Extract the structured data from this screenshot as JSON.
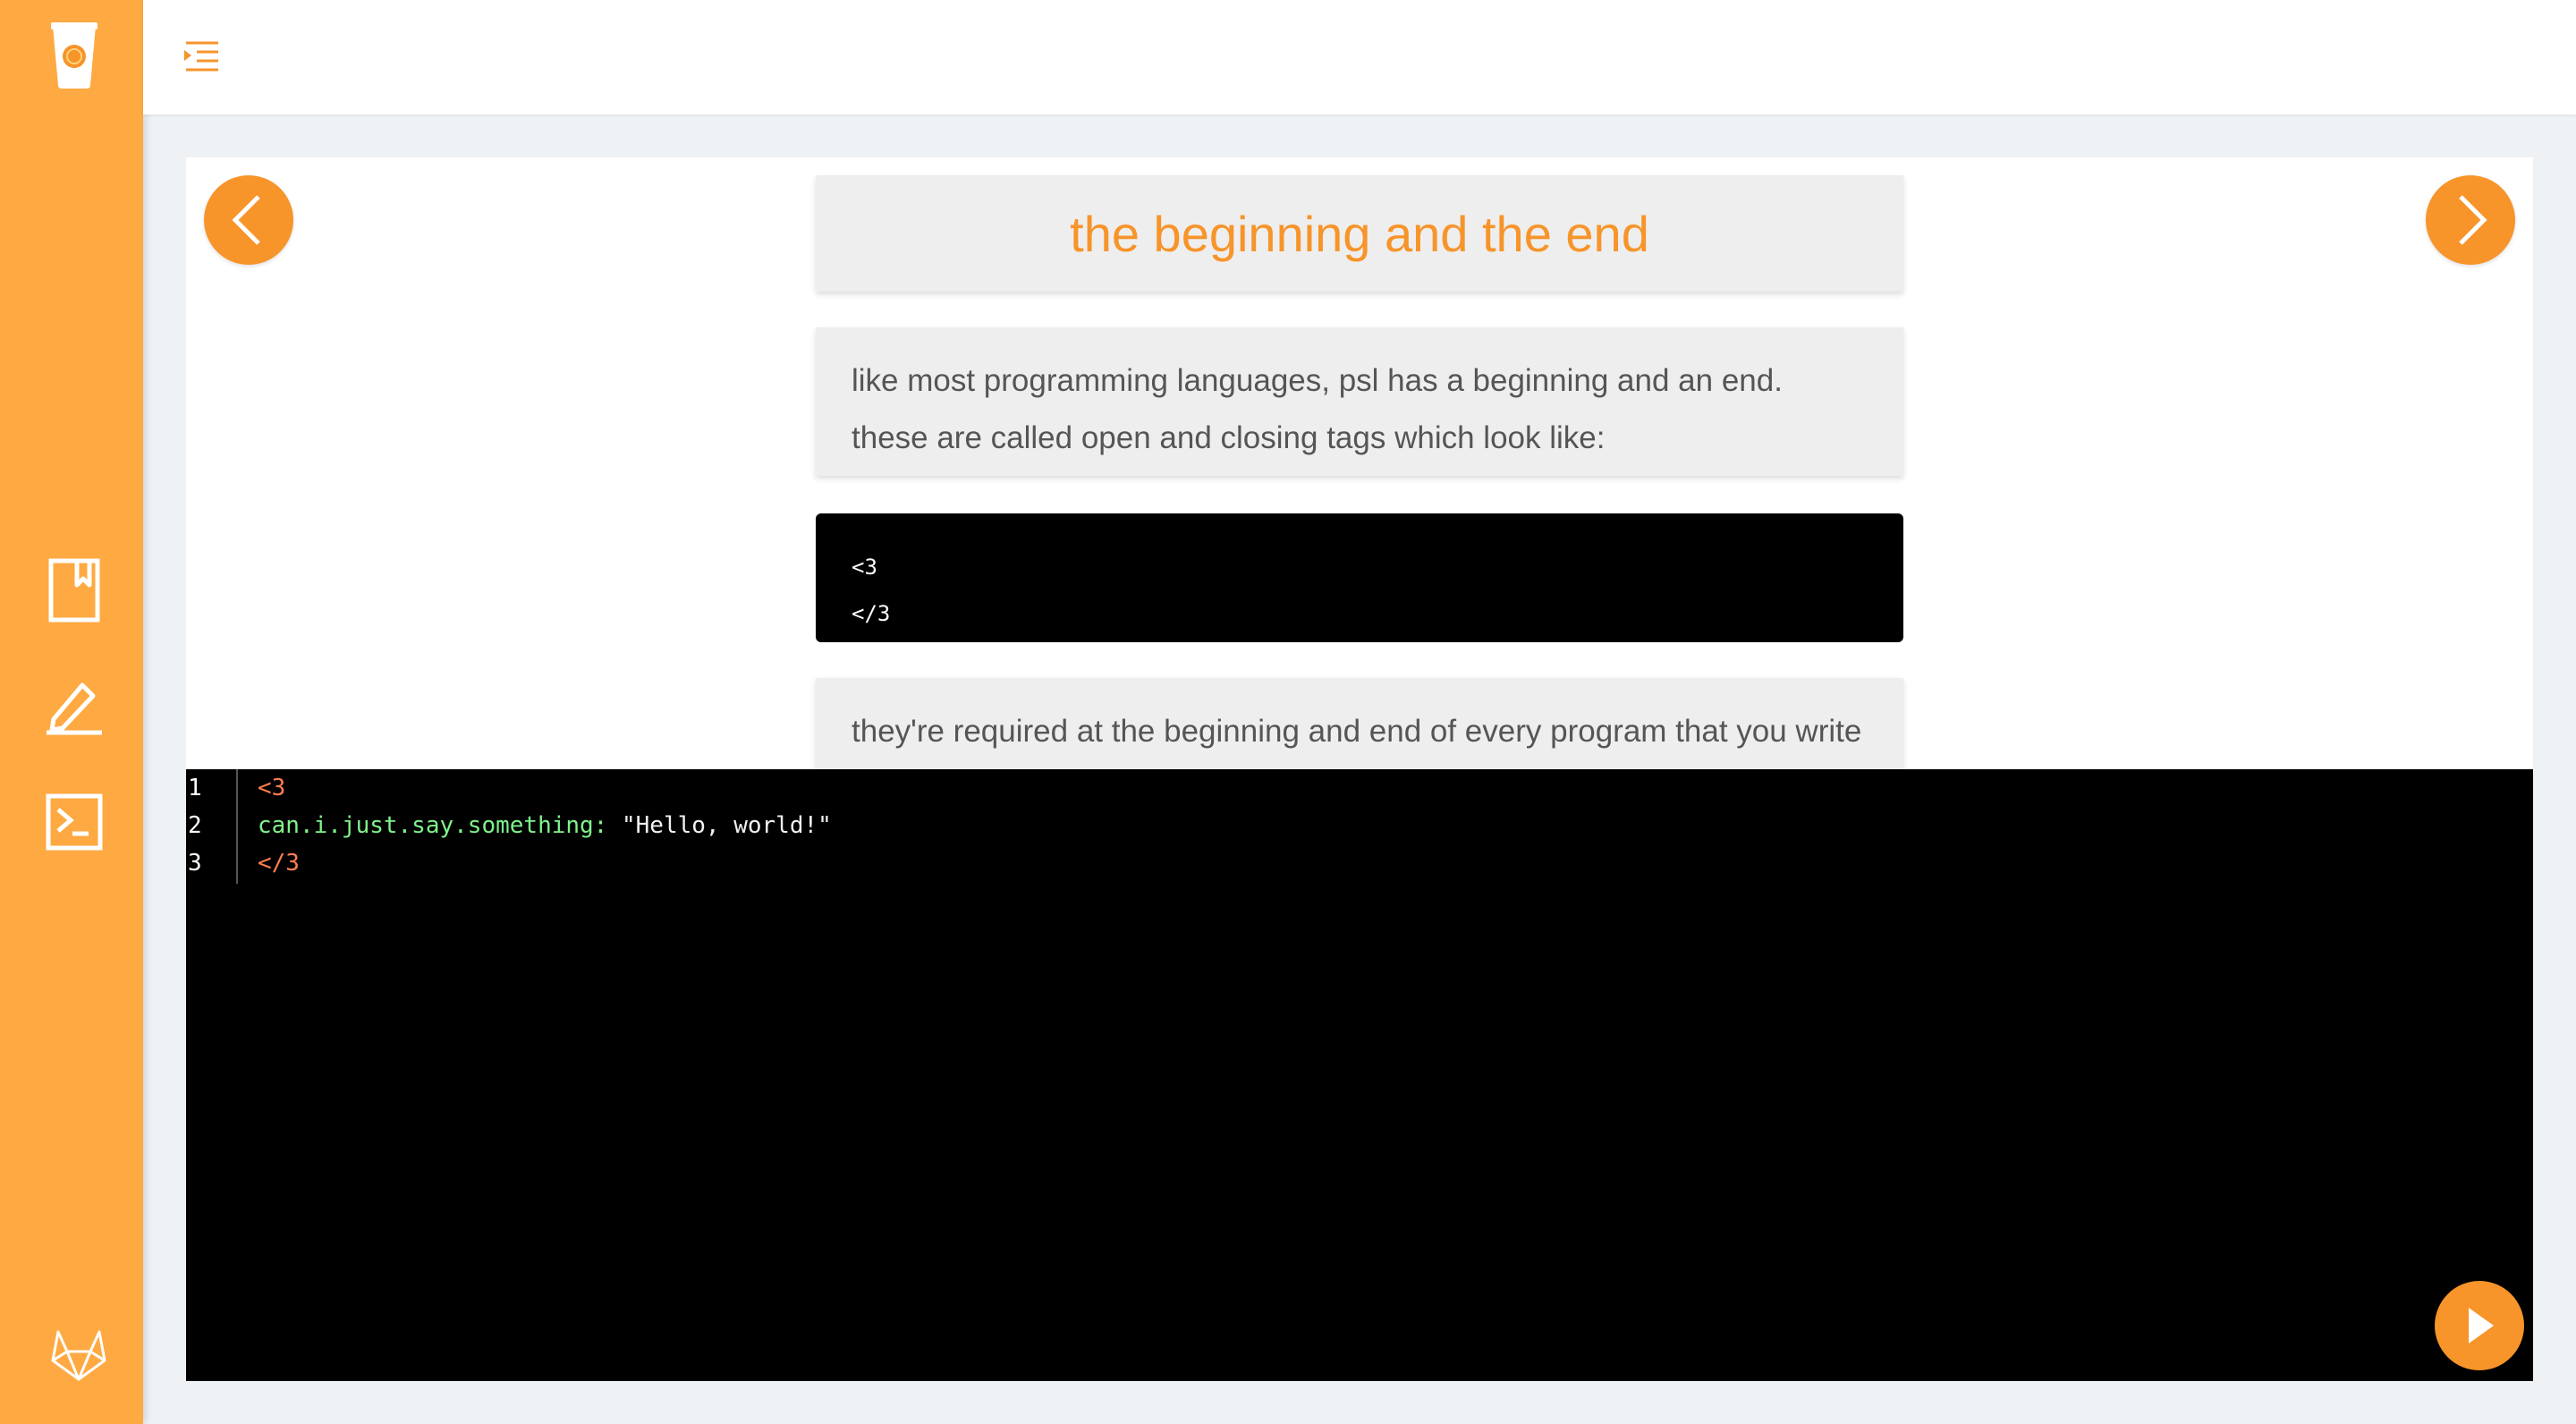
{
  "colors": {
    "sidebar": "#fea942",
    "accent": "#f7942a",
    "code_tag": "#ff7e4f",
    "code_key": "#7ff28a"
  },
  "sidebar": {
    "items": [
      {
        "icon": "coffee-cup-logo-icon"
      },
      {
        "icon": "bookmark-book-icon"
      },
      {
        "icon": "pencil-edit-icon"
      },
      {
        "icon": "terminal-icon"
      },
      {
        "icon": "gitlab-icon"
      }
    ]
  },
  "topbar": {
    "menu_icon": "menu-indent-icon"
  },
  "lesson": {
    "title": "the beginning and the end",
    "paragraph1": "like most programming languages, psl has a beginning and an end. these are called open and closing tags which look like:",
    "code_example": [
      "<3",
      "</3"
    ],
    "paragraph2": "they're required at the beginning and end of every program that you write in psl."
  },
  "editor": {
    "line_numbers": [
      "1",
      "2",
      "3"
    ],
    "lines": [
      {
        "tag": "<3"
      },
      {
        "key": "can.i.just.say.something:",
        "value": " \"Hello, world!\""
      },
      {
        "tag": "</3"
      }
    ]
  }
}
